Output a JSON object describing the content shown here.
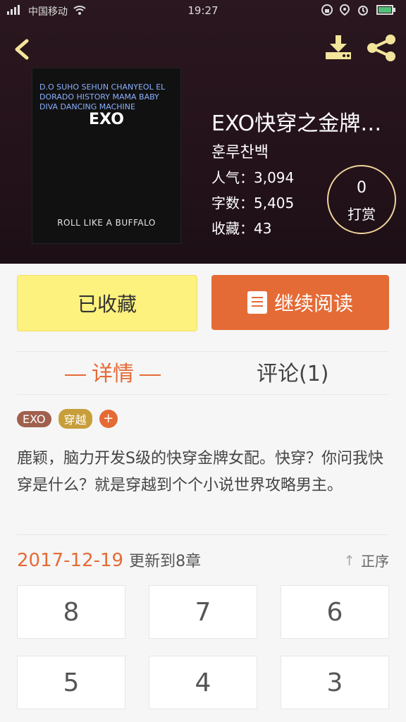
{
  "status_bar": {
    "carrier": "中国移动",
    "time": "19:27"
  },
  "book": {
    "title": "EXO快穿之金牌…",
    "author": "훈루찬백",
    "popularity_label": "人气",
    "popularity": "3,094",
    "words_label": "字数",
    "words": "5,405",
    "favorites_label": "收藏",
    "favorites": "43",
    "reward_count": "0",
    "reward_label": "打赏"
  },
  "cover_art": {
    "center_text": "EXO",
    "tags_line": "D.O  SUHO  SEHUN  CHANYEOL  EL DORADO  HISTORY  MAMA  BABY  DIVA  DANCING MACHINE",
    "bottom_line": "ROLL LIKE A BUFFALO"
  },
  "actions": {
    "collected_label": "已收藏",
    "continue_label": "继续阅读"
  },
  "tabs": {
    "detail": "详情",
    "comment": "评论(1)"
  },
  "tags": [
    {
      "label": "EXO"
    },
    {
      "label": "穿越"
    }
  ],
  "description": "鹿颖，脑力开发S级的快穿金牌女配。快穿？你问我快穿是什么？就是穿越到个个小说世界攻略男主。",
  "update": {
    "date": "2017-12-19",
    "text": "更新到8章",
    "order_label": "正序"
  },
  "chapters": [
    "8",
    "7",
    "6",
    "5",
    "4",
    "3"
  ]
}
